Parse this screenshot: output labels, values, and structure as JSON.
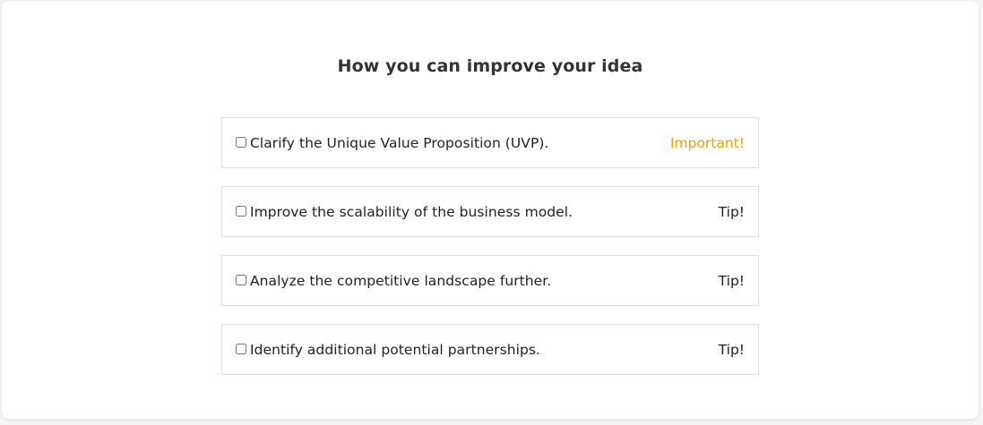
{
  "heading": "How you can improve your idea",
  "colors": {
    "important": "#e8a200",
    "text": "#222222",
    "border": "#dedede"
  },
  "items": [
    {
      "label": "Clarify the Unique Value Proposition (UVP).",
      "tag": "Important!",
      "tag_type": "important",
      "checked": false
    },
    {
      "label": "Improve the scalability of the business model.",
      "tag": "Tip!",
      "tag_type": "tip",
      "checked": false
    },
    {
      "label": "Analyze the competitive landscape further.",
      "tag": "Tip!",
      "tag_type": "tip",
      "checked": false
    },
    {
      "label": "Identify additional potential partnerships.",
      "tag": "Tip!",
      "tag_type": "tip",
      "checked": false
    }
  ]
}
